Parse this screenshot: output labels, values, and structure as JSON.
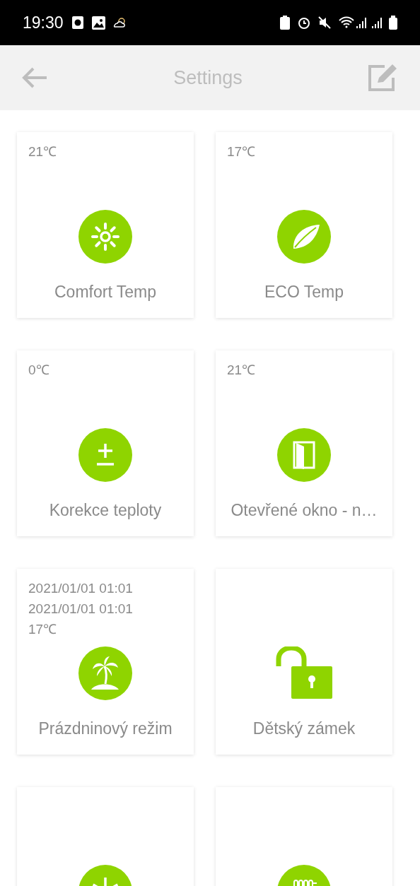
{
  "status_bar": {
    "time": "19:30"
  },
  "header": {
    "title": "Settings"
  },
  "cards": [
    {
      "kind": "sun",
      "values": [
        "21℃"
      ],
      "label": "Comfort Temp"
    },
    {
      "kind": "leaf",
      "values": [
        "17℃"
      ],
      "label": "ECO Temp"
    },
    {
      "kind": "plusminus",
      "values": [
        "0℃"
      ],
      "label": "Korekce teploty"
    },
    {
      "kind": "door",
      "values": [
        "21℃"
      ],
      "label": "Otevřené okno - n…"
    },
    {
      "kind": "palm",
      "values": [
        "2021/01/01 01:01",
        "2021/01/01 01:01",
        "17℃"
      ],
      "label": "Prázdninový režim"
    },
    {
      "kind": "lock",
      "label": "Dětský zámek"
    },
    {
      "kind": "snowflake"
    },
    {
      "kind": "radiator"
    }
  ]
}
